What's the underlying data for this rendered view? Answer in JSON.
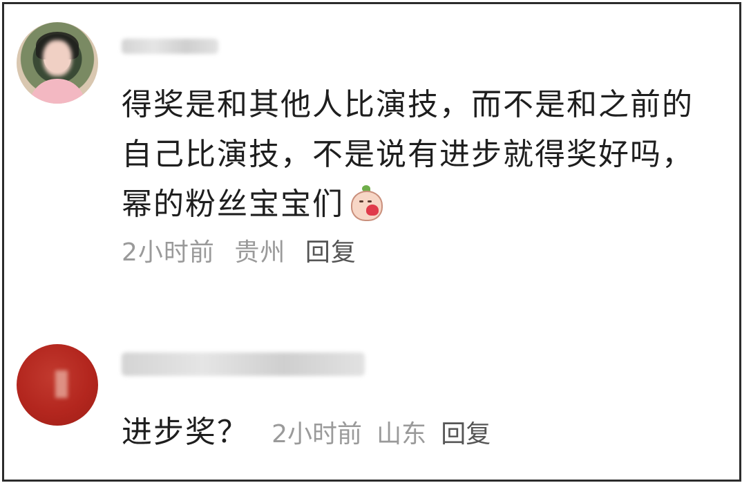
{
  "comments": [
    {
      "text": "得奖是和其他人比演技，而不是和之前的自己比演技，不是说有进步就得奖好吗，幂的粉丝宝宝们",
      "emoji": "blushing-peach-emoji",
      "time": "2小时前",
      "location": "贵州",
      "reply_label": "回复"
    },
    {
      "text": "进步奖？",
      "time": "2小时前",
      "location": "山东",
      "reply_label": "回复"
    }
  ],
  "colors": {
    "text": "#1e1e1e",
    "meta": "#9a9a9a",
    "reply": "#555555",
    "border": "#2b2b2b"
  }
}
